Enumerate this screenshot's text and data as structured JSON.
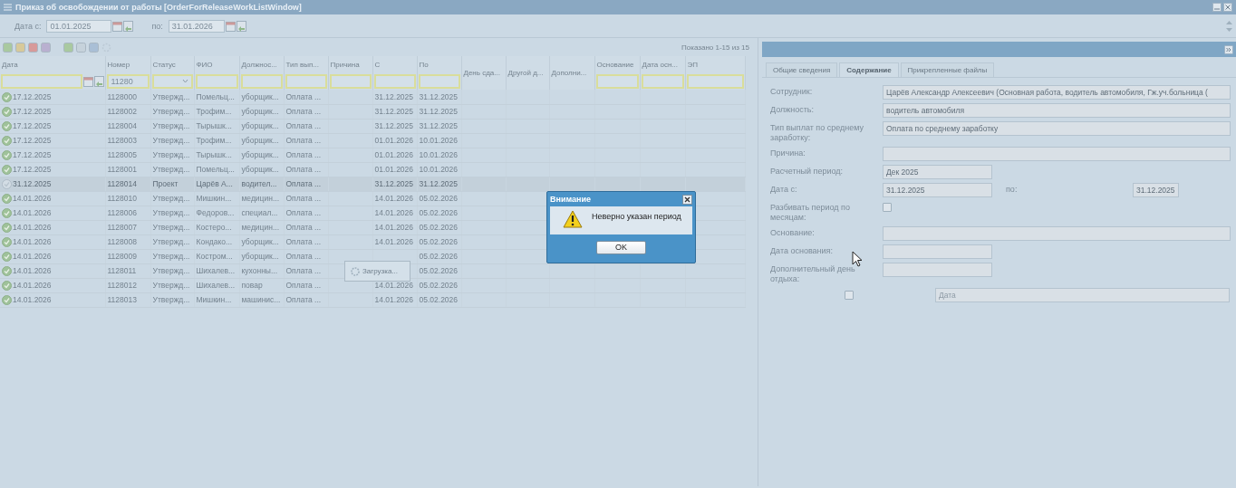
{
  "window": {
    "title": "Приказ об освобождении от работы [OrderForReleaseWorkListWindow]"
  },
  "period": {
    "from_label": "Дата с:",
    "from_value": "01.01.2025",
    "to_label": "по:",
    "to_value": "31.01.2026"
  },
  "grid": {
    "paging": "Показано 1-15 из 15",
    "columns": [
      {
        "label": "Дата",
        "kind": "date"
      },
      {
        "label": "Номер",
        "kind": "text",
        "value": "11280"
      },
      {
        "label": "Статус",
        "kind": "select"
      },
      {
        "label": "ФИО",
        "kind": "text"
      },
      {
        "label": "Должнос...",
        "kind": "text"
      },
      {
        "label": "Тип вып...",
        "kind": "text"
      },
      {
        "label": "Причина",
        "kind": "text"
      },
      {
        "label": "С",
        "kind": "text"
      },
      {
        "label": "По",
        "kind": "text"
      },
      {
        "label": "День сда...",
        "kind": "tall"
      },
      {
        "label": "Другой д...",
        "kind": "tall"
      },
      {
        "label": "Дополни...",
        "kind": "tall"
      },
      {
        "label": "Основание",
        "kind": "text"
      },
      {
        "label": "Дата осн...",
        "kind": "text"
      },
      {
        "label": "ЭП",
        "kind": "text"
      }
    ],
    "rows": [
      {
        "approved": true,
        "selected": false,
        "date": "17.12.2025",
        "number": "1128000",
        "status": "Утвержд...",
        "name": "Помельц...",
        "position": "уборщик...",
        "pay_type": "Оплата ...",
        "from": "31.12.2025",
        "to": "31.12.2025"
      },
      {
        "approved": true,
        "selected": false,
        "date": "17.12.2025",
        "number": "1128002",
        "status": "Утвержд...",
        "name": "Трофим...",
        "position": "уборщик...",
        "pay_type": "Оплата ...",
        "from": "31.12.2025",
        "to": "31.12.2025"
      },
      {
        "approved": true,
        "selected": false,
        "date": "17.12.2025",
        "number": "1128004",
        "status": "Утвержд...",
        "name": "Тырышк...",
        "position": "уборщик...",
        "pay_type": "Оплата ...",
        "from": "31.12.2025",
        "to": "31.12.2025"
      },
      {
        "approved": true,
        "selected": false,
        "date": "17.12.2025",
        "number": "1128003",
        "status": "Утвержд...",
        "name": "Трофим...",
        "position": "уборщик...",
        "pay_type": "Оплата ...",
        "from": "01.01.2026",
        "to": "10.01.2026"
      },
      {
        "approved": true,
        "selected": false,
        "date": "17.12.2025",
        "number": "1128005",
        "status": "Утвержд...",
        "name": "Тырышк...",
        "position": "уборщик...",
        "pay_type": "Оплата ...",
        "from": "01.01.2026",
        "to": "10.01.2026"
      },
      {
        "approved": true,
        "selected": false,
        "date": "17.12.2025",
        "number": "1128001",
        "status": "Утвержд...",
        "name": "Помельц...",
        "position": "уборщик...",
        "pay_type": "Оплата ...",
        "from": "01.01.2026",
        "to": "10.01.2026"
      },
      {
        "approved": false,
        "selected": true,
        "date": "31.12.2025",
        "number": "1128014",
        "status": "Проект",
        "name": "Царёв А...",
        "position": "водител...",
        "pay_type": "Оплата ...",
        "from": "31.12.2025",
        "to": "31.12.2025"
      },
      {
        "approved": true,
        "selected": false,
        "date": "14.01.2026",
        "number": "1128010",
        "status": "Утвержд...",
        "name": "Мишкин...",
        "position": "медицин...",
        "pay_type": "Оплата ...",
        "from": "14.01.2026",
        "to": "05.02.2026"
      },
      {
        "approved": true,
        "selected": false,
        "date": "14.01.2026",
        "number": "1128006",
        "status": "Утвержд...",
        "name": "Федоров...",
        "position": "специал...",
        "pay_type": "Оплата ...",
        "from": "14.01.2026",
        "to": "05.02.2026"
      },
      {
        "approved": true,
        "selected": false,
        "date": "14.01.2026",
        "number": "1128007",
        "status": "Утвержд...",
        "name": "Костеро...",
        "position": "медицин...",
        "pay_type": "Оплата ...",
        "from": "14.01.2026",
        "to": "05.02.2026"
      },
      {
        "approved": true,
        "selected": false,
        "date": "14.01.2026",
        "number": "1128008",
        "status": "Утвержд...",
        "name": "Кондако...",
        "position": "уборщик...",
        "pay_type": "Оплата ...",
        "from": "14.01.2026",
        "to": "05.02.2026"
      },
      {
        "approved": true,
        "selected": false,
        "date": "14.01.2026",
        "number": "1128009",
        "status": "Утвержд...",
        "name": "Костром...",
        "position": "уборщик...",
        "pay_type": "Оплата ...",
        "to": "05.02.2026"
      },
      {
        "approved": true,
        "selected": false,
        "date": "14.01.2026",
        "number": "1128011",
        "status": "Утвержд...",
        "name": "Шихалев...",
        "position": "кухонны...",
        "pay_type": "Оплата ...",
        "to": "05.02.2026"
      },
      {
        "approved": true,
        "selected": false,
        "date": "14.01.2026",
        "number": "1128012",
        "status": "Утвержд...",
        "name": "Шихалев...",
        "position": "повар",
        "pay_type": "Оплата ...",
        "from": "14.01.2026",
        "to": "05.02.2026"
      },
      {
        "approved": true,
        "selected": false,
        "date": "14.01.2026",
        "number": "1128013",
        "status": "Утвержд...",
        "name": "Мишкин...",
        "position": "машинис...",
        "pay_type": "Оплата ...",
        "from": "14.01.2026",
        "to": "05.02.2026"
      }
    ]
  },
  "loading": {
    "text": "Загрузка..."
  },
  "details": {
    "tabs": [
      {
        "label": "Общие сведения",
        "selected": false
      },
      {
        "label": "Содержание",
        "selected": true
      },
      {
        "label": "Прикрепленные файлы",
        "selected": false
      }
    ],
    "fields": [
      {
        "kind": "wide",
        "label": "Сотрудник:",
        "value": "Царёв Александр Алексеевич (Основная работа, водитель автомобиля, Гж.уч.больница ("
      },
      {
        "kind": "wide",
        "label": "Должность:",
        "value": "водитель автомобиля"
      },
      {
        "kind": "wide",
        "label": "Тип выплат по среднему заработку:",
        "value": "Оплата по среднему заработку"
      },
      {
        "kind": "wide",
        "label": "Причина:"
      },
      {
        "kind": "short",
        "label": "Расчетный период:",
        "value": "Дек 2025"
      },
      {
        "kind": "range",
        "label": "Дата с:",
        "value": "31.12.2025",
        "to_label": "по:",
        "to_value": "31.12.2025"
      },
      {
        "kind": "check",
        "label": "Разбивать период по месяцам:",
        "checked": false
      },
      {
        "kind": "wide",
        "label": "Основание:"
      },
      {
        "kind": "short",
        "label": "Дата основания:"
      },
      {
        "kind": "short",
        "label": "Дополнительный день отдыха:"
      },
      {
        "kind": "check-date",
        "checked": false,
        "placeholder": "Дата"
      }
    ]
  },
  "dialog": {
    "title": "Внимание",
    "message": "Неверно указан период",
    "button": "OK"
  }
}
